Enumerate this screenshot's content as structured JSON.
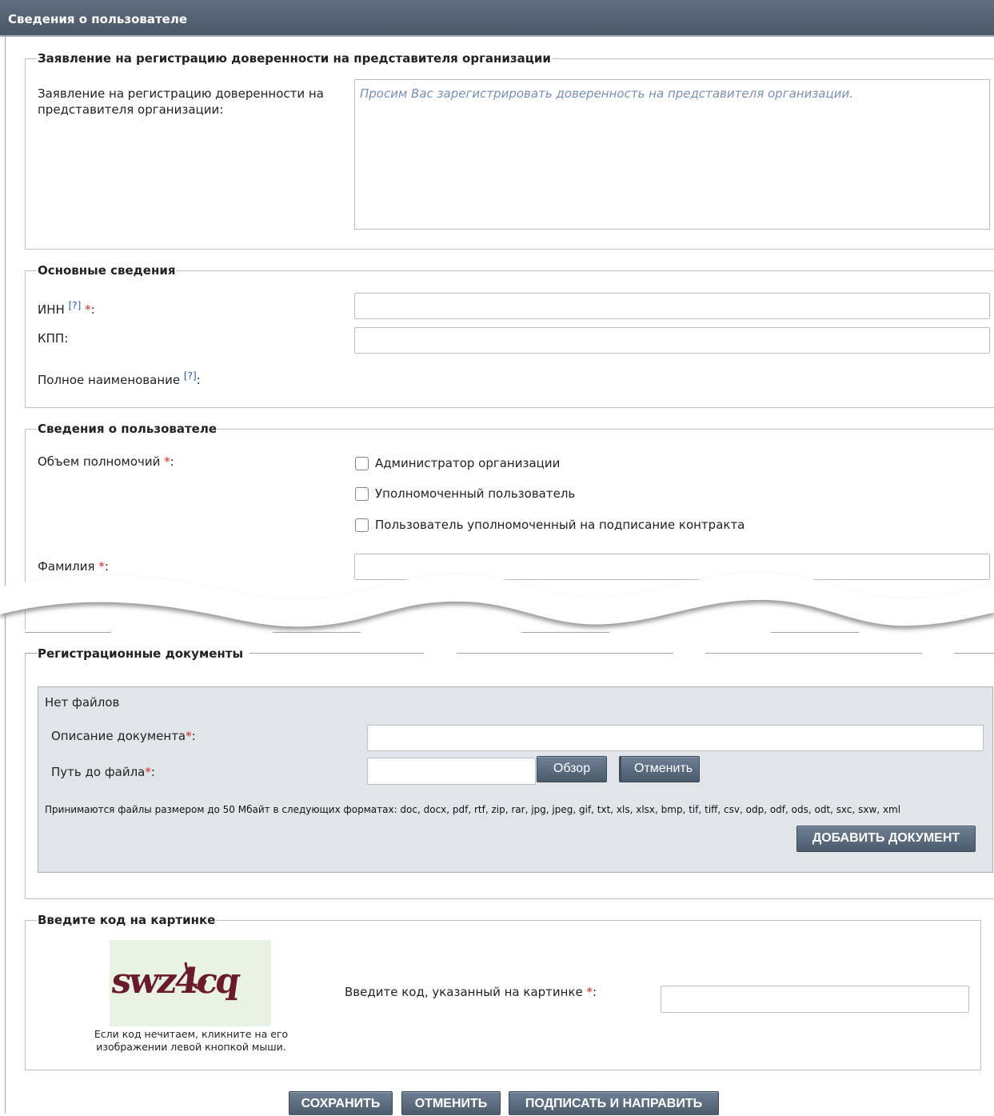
{
  "header": {
    "title": "Сведения о пользователе"
  },
  "statement": {
    "legend": "Заявление на регистрацию доверенности на представителя организации",
    "label": "Заявление на регистрацию доверенности на представителя организации:",
    "value": "Просим Вас зарегистрировать доверенность на представителя организации."
  },
  "basic": {
    "legend": "Основные сведения",
    "inn_label": "ИНН",
    "kpp_label": "КПП:",
    "fullname_label": "Полное наименование",
    "help_mark": "[?]",
    "required_mark": "*",
    "colon": ":"
  },
  "user": {
    "legend": "Сведения о пользователе",
    "scope_label": "Объем полномочий",
    "options": [
      {
        "label": "Администратор организации",
        "checked": false
      },
      {
        "label": "Уполномоченный пользователь",
        "checked": false
      },
      {
        "label": "Пользователь уполномоченный на подписание контракта",
        "checked": false
      }
    ],
    "surname_label": "Фамилия"
  },
  "documents": {
    "legend": "Регистрационные документы",
    "no_files": "Нет файлов",
    "description_label": "Описание документа",
    "path_label": "Путь до файла",
    "browse_button": "Обзор",
    "cancel_file_button": "Отменить",
    "formats_note": "Принимаются файлы размером до 50 Мбайт в следующих форматах: doc, docx, pdf, rtf, zip, rar, jpg, jpeg, gif, txt, xls, xlsx, bmp, tif, tiff, csv, odp, odf, ods, odt, sxc, sxw, xml",
    "add_button": "ДОБАВИТЬ ДОКУМЕНТ"
  },
  "captcha": {
    "legend": "Введите код на картинке",
    "image_text": "swz4cq",
    "hint": "Если код нечитаем, кликните на его изображении левой кнопкой мыши.",
    "input_label": "Введите код, указанный на картинке"
  },
  "actions": {
    "save": "СОХРАНИТЬ",
    "cancel": "ОТМЕНИТЬ",
    "sign_send": "ПОДПИСАТЬ И НАПРАВИТЬ"
  },
  "colors": {
    "header_bg": "#4f5d6e",
    "button_bg": "#56667a",
    "required": "#e02020",
    "help_link": "#2255cc",
    "panel_bg": "#e1e5ea"
  }
}
